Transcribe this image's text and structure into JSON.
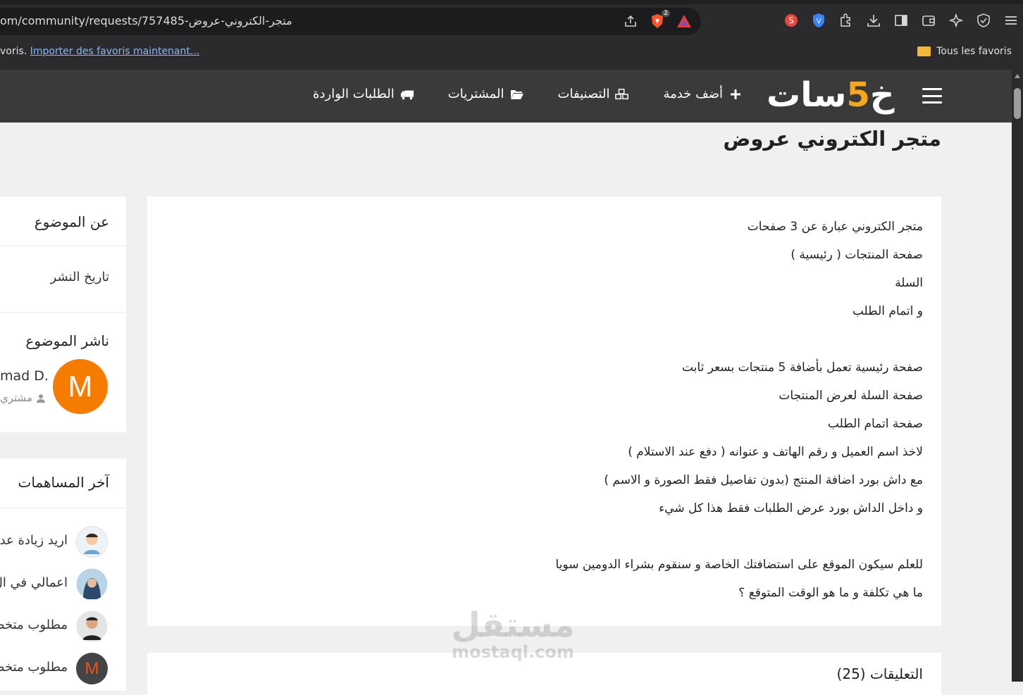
{
  "browser": {
    "url": "om/community/requests/757485-متجر-الكتروني-عروض",
    "share_badge": "2",
    "bookmarks_prefix": "voris.",
    "bookmarks_import_link": "Importer des favoris maintenant...",
    "all_bookmarks": "Tous les favoris"
  },
  "site": {
    "logo_start": "خ",
    "logo_accent": "5",
    "logo_end": "سات",
    "nav": [
      {
        "label": "أضف خدمة",
        "icon": "plus-icon"
      },
      {
        "label": "التصنيفات",
        "icon": "cubes-icon"
      },
      {
        "label": "المشتريات",
        "icon": "folder-open-icon"
      },
      {
        "label": "الطلبات الواردة",
        "icon": "truck-icon"
      }
    ]
  },
  "request": {
    "title": "متجر الكتروني عروض",
    "description_lines": [
      "متجر الكتروني عبارة عن 3 صفحات",
      "صفحة المنتجات ( رئيسية )",
      "السلة",
      "و اتمام الطلب",
      "",
      "صفحة رئيسية تعمل بأضافة 5 منتجات بسعر ثابت",
      "صفحة السلة لعرض المنتجات",
      "صفحة اتمام الطلب",
      "لاخذ اسم العميل و رقم الهاتف و عنوانه ( دفع عند الاستلام )",
      "مع داش بورد اضافة المنتج (بدون تفاصيل فقط الصورة و الاسم )",
      "و داخل الداش بورد عرض الطلبات فقط هذا كل شيء",
      "",
      "للعلم سيكون الموقع على استضافتك الخاصة و سنقوم بشراء الدومين سويا",
      "ما هي تكلفة و ما هو الوقت المتوقع ؟"
    ],
    "comments_title": "التعليقات (25)"
  },
  "sidebar": {
    "about_title": "عن الموضوع",
    "publish_date_label": "تاريخ النشر",
    "publisher_title": "ناشر الموضوع",
    "publisher_initial": "M",
    "publisher_name": "mad D.",
    "publisher_role": "مشتري",
    "latest_title": "آخر المساهمات",
    "contributions": [
      {
        "text": "اريد زيادة عدد",
        "avatar": "cartoon"
      },
      {
        "text": "اعمالي في ال",
        "avatar": "hijab"
      },
      {
        "text": "مطلوب متخصص",
        "avatar": "man"
      },
      {
        "text": "مطلوب متخصص",
        "avatar": "letter",
        "initial": "M"
      }
    ]
  },
  "watermark": {
    "ar": "مستقل",
    "en": "mostaql.com"
  },
  "colors": {
    "accent": "#f5a623",
    "avatar_orange": "#f57c00",
    "header_bg": "#3a3a3a"
  }
}
